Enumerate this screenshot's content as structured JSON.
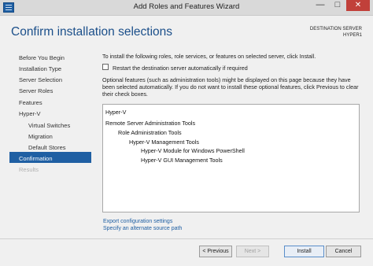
{
  "window": {
    "title": "Add Roles and Features Wizard",
    "controls": {
      "minimize": "—",
      "maximize": "□",
      "close": "✕"
    }
  },
  "header": {
    "page_title": "Confirm installation selections",
    "destination_label": "DESTINATION SERVER",
    "destination_server": "HYPER1"
  },
  "nav": {
    "items": [
      {
        "label": "Before You Begin",
        "state": "normal",
        "sub": false
      },
      {
        "label": "Installation Type",
        "state": "normal",
        "sub": false
      },
      {
        "label": "Server Selection",
        "state": "normal",
        "sub": false
      },
      {
        "label": "Server Roles",
        "state": "normal",
        "sub": false
      },
      {
        "label": "Features",
        "state": "normal",
        "sub": false
      },
      {
        "label": "Hyper-V",
        "state": "normal",
        "sub": false
      },
      {
        "label": "Virtual Switches",
        "state": "normal",
        "sub": true
      },
      {
        "label": "Migration",
        "state": "normal",
        "sub": true
      },
      {
        "label": "Default Stores",
        "state": "normal",
        "sub": true
      },
      {
        "label": "Confirmation",
        "state": "active",
        "sub": false
      },
      {
        "label": "Results",
        "state": "disabled",
        "sub": false
      }
    ]
  },
  "main": {
    "intro": "To install the following roles, role services, or features on selected server, click Install.",
    "restart_checkbox_label": "Restart the destination server automatically if required",
    "restart_checked": false,
    "optional_note_line1": "Optional features (such as administration tools) might be displayed on this page because they have",
    "optional_note_line2": "been selected automatically. If you do not want to install these optional features, click Previous to clear",
    "optional_note_line3": "their check boxes.",
    "features": [
      "Hyper-V",
      "Remote Server Administration Tools",
      "Role Administration Tools",
      "Hyper-V Management Tools",
      "Hyper-V Module for Windows PowerShell",
      "Hyper-V GUI Management Tools"
    ],
    "export_link": "Export configuration settings",
    "alt_source_link": "Specify an alternate source path"
  },
  "footer": {
    "previous": "< Previous",
    "next": "Next >",
    "install": "Install",
    "cancel": "Cancel"
  },
  "colors": {
    "accent": "#1f5fa3",
    "title_text": "#1b4f8a",
    "close_button": "#c1403a"
  }
}
